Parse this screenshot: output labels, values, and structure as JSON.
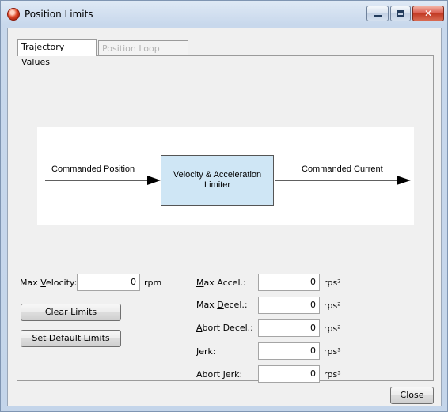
{
  "window": {
    "title": "Position Limits",
    "close_glyph": "✕"
  },
  "tabs": [
    {
      "label": "Trajectory Values",
      "active": true
    },
    {
      "label": "Position Loop Values",
      "active": false
    }
  ],
  "diagram": {
    "input_label": "Commanded Position",
    "block_label": "Velocity & Acceleration Limiter",
    "output_label": "Commanded Current"
  },
  "velocity": {
    "label_pre": "Max ",
    "label_mnemonic": "V",
    "label_post": "elocity:",
    "value": "0",
    "unit": "rpm"
  },
  "buttons": {
    "clear_pre": "C",
    "clear_mnemonic": "l",
    "clear_post": "ear Limits",
    "default_mnemonic": "S",
    "default_post": "et Default Limits",
    "close": "Close"
  },
  "limits": [
    {
      "label_pre": "",
      "label_mnemonic": "M",
      "label_post": "ax Accel.:",
      "value": "0",
      "unit": "rps²"
    },
    {
      "label_pre": "Max ",
      "label_mnemonic": "D",
      "label_post": "ecel.:",
      "value": "0",
      "unit": "rps²"
    },
    {
      "label_pre": "",
      "label_mnemonic": "A",
      "label_post": "bort Decel.:",
      "value": "0",
      "unit": "rps²"
    },
    {
      "label_pre": "",
      "label_mnemonic": "J",
      "label_post": "erk:",
      "value": "0",
      "unit": "rps³"
    },
    {
      "label_pre": "Abort Jerk:",
      "label_mnemonic": "",
      "label_post": "",
      "value": "0",
      "unit": "rps³"
    }
  ],
  "colors": {
    "limiter_fill": "#cfe6f5",
    "close_button": "#c23a24"
  }
}
